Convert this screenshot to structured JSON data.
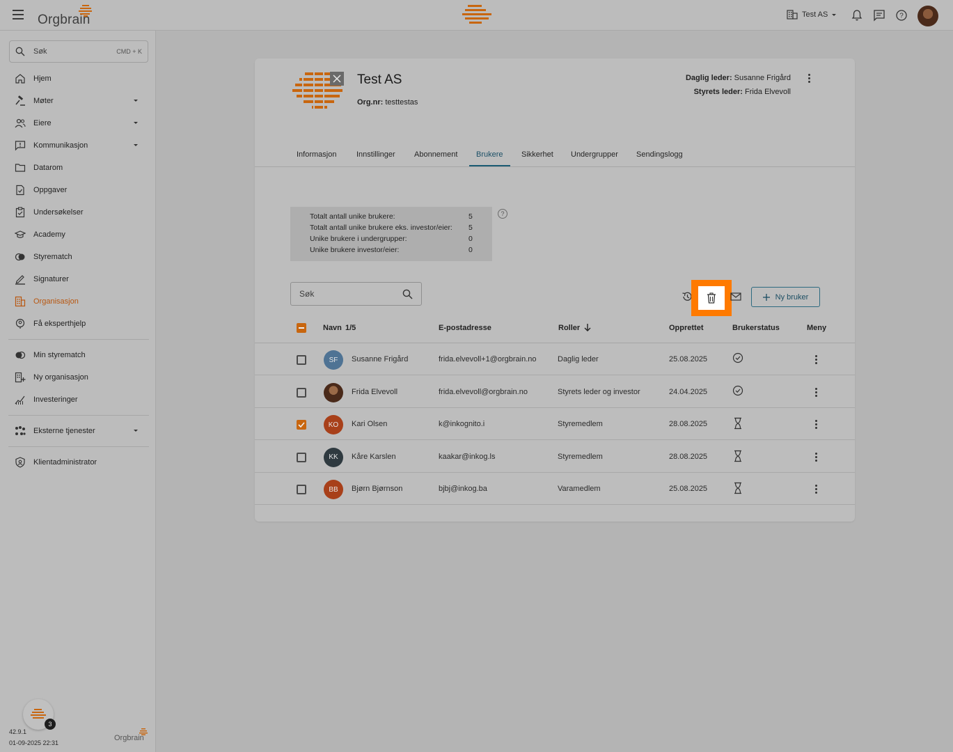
{
  "topbar": {
    "brand": "Orgbrain",
    "org_switch_label": "Test AS",
    "colors": {
      "brand_orange": "#c8660f",
      "accent_teal": "#1b5b73"
    }
  },
  "sidebar": {
    "search_label": "Søk",
    "search_shortcut": "CMD + K",
    "items": [
      {
        "label": "Hjem",
        "icon": "home-icon"
      },
      {
        "label": "Møter",
        "icon": "gavel-icon",
        "expandable": true
      },
      {
        "label": "Eiere",
        "icon": "people-icon",
        "expandable": true
      },
      {
        "label": "Kommunikasjon",
        "icon": "message-alert-icon",
        "expandable": true
      },
      {
        "label": "Datarom",
        "icon": "folder-icon"
      },
      {
        "label": "Oppgaver",
        "icon": "task-icon"
      },
      {
        "label": "Undersøkelser",
        "icon": "survey-icon"
      },
      {
        "label": "Academy",
        "icon": "graduation-cap-icon"
      },
      {
        "label": "Styrematch",
        "icon": "match-icon"
      },
      {
        "label": "Signaturer",
        "icon": "pen-icon"
      },
      {
        "label": "Organisasjon",
        "icon": "building-icon",
        "active": true
      },
      {
        "label": "Få eksperthjelp",
        "icon": "expert-help-icon"
      }
    ],
    "items2": [
      {
        "label": "Min styrematch",
        "icon": "toggle-icon"
      },
      {
        "label": "Ny organisasjon",
        "icon": "building-add-icon"
      },
      {
        "label": "Investeringer",
        "icon": "chart-line-icon"
      }
    ],
    "items3": [
      {
        "label": "Eksterne tjenester",
        "icon": "apps-icon",
        "expandable": true
      }
    ],
    "items4": [
      {
        "label": "Klientadministrator",
        "icon": "shield-person-icon"
      }
    ],
    "notification_count": "3",
    "version": "42.9.1",
    "build_date": "01-09-2025 22:31",
    "footer_brand": "Orgbrain"
  },
  "org": {
    "name": "Test AS",
    "orgnr_label": "Org.nr:",
    "orgnr_value": "testtestas",
    "daglig_leder_label": "Daglig leder:",
    "daglig_leder_value": "Susanne Frigård",
    "styrets_leder_label": "Styrets leder:",
    "styrets_leder_value": "Frida Elvevoll"
  },
  "tabs": [
    "Informasjon",
    "Innstillinger",
    "Abonnement",
    "Brukere",
    "Sikkerhet",
    "Undergrupper",
    "Sendingslogg"
  ],
  "active_tab": "Brukere",
  "stats": [
    {
      "label": "Totalt antall unike brukere:",
      "value": "5"
    },
    {
      "label": "Totalt antall unike brukere eks. investor/eier:",
      "value": "5"
    },
    {
      "label": "Unike brukere i undergrupper:",
      "value": "0"
    },
    {
      "label": "Unike brukere investor/eier:",
      "value": "0"
    }
  ],
  "toolbar": {
    "search_placeholder": "Søk",
    "new_user_label": "Ny bruker"
  },
  "table": {
    "headers": {
      "name": "Navn",
      "selection_count": "1/5",
      "email": "E-postadresse",
      "roles": "Roller",
      "created": "Opprettet",
      "status": "Brukerstatus",
      "menu": "Meny"
    },
    "rows": [
      {
        "initials": "SF",
        "avatar_color": "#4f7394",
        "name": "Susanne Frigård",
        "email": "frida.elvevoll+1@orgbrain.no",
        "role": "Daglig leder",
        "created": "25.08.2025",
        "status": "active",
        "checked": false
      },
      {
        "initials": "",
        "avatar_color": "#5a3522",
        "photo": true,
        "name": "Frida Elvevoll",
        "email": "frida.elvevoll@orgbrain.no",
        "role": "Styrets leder og investor",
        "created": "24.04.2025",
        "status": "active",
        "checked": false
      },
      {
        "initials": "KO",
        "avatar_color": "#a8401a",
        "name": "Kari Olsen",
        "email": "k@inkognito.i",
        "role": "Styremedlem",
        "created": "28.08.2025",
        "status": "pending",
        "checked": true
      },
      {
        "initials": "KK",
        "avatar_color": "#2f3a40",
        "name": "Kåre Karslen",
        "email": "kaakar@inkog.ls",
        "role": "Styremedlem",
        "created": "28.08.2025",
        "status": "pending",
        "checked": false
      },
      {
        "initials": "BB",
        "avatar_color": "#a8401a",
        "name": "Bjørn Bjørnson",
        "email": "bjbj@inkog.ba",
        "role": "Varamedlem",
        "created": "25.08.2025",
        "status": "pending",
        "checked": false
      }
    ]
  }
}
